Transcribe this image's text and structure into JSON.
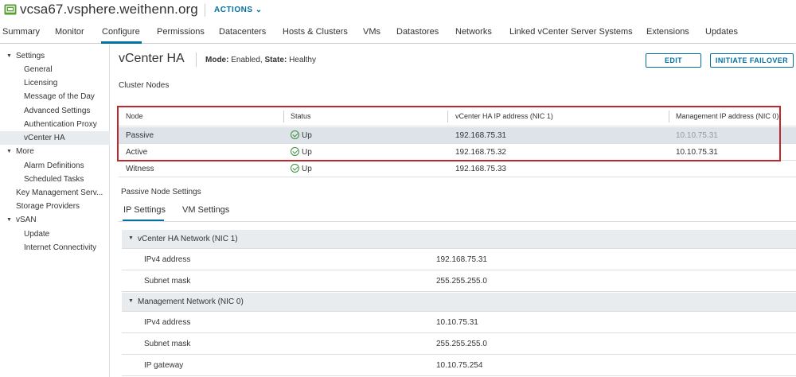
{
  "header": {
    "object_name": "vcsa67.vsphere.weithenn.org",
    "actions_label": "ACTIONS ⌄"
  },
  "tabs": [
    {
      "label": "Summary"
    },
    {
      "label": "Monitor"
    },
    {
      "label": "Configure"
    },
    {
      "label": "Permissions"
    },
    {
      "label": "Datacenters"
    },
    {
      "label": "Hosts & Clusters"
    },
    {
      "label": "VMs"
    },
    {
      "label": "Datastores"
    },
    {
      "label": "Networks"
    },
    {
      "label": "Linked vCenter Server Systems"
    },
    {
      "label": "Extensions"
    },
    {
      "label": "Updates"
    }
  ],
  "sidebar": {
    "groups": [
      {
        "label": "Settings"
      },
      {
        "label": "More"
      },
      {
        "label": "vSAN"
      }
    ],
    "items": [
      {
        "label": "General"
      },
      {
        "label": "Licensing"
      },
      {
        "label": "Message of the Day"
      },
      {
        "label": "Advanced Settings"
      },
      {
        "label": "Authentication Proxy"
      },
      {
        "label": "vCenter HA"
      },
      {
        "label": "Alarm Definitions"
      },
      {
        "label": "Scheduled Tasks"
      },
      {
        "label": "Key Management Serv..."
      },
      {
        "label": "Storage Providers"
      },
      {
        "label": "Update"
      },
      {
        "label": "Internet Connectivity"
      }
    ]
  },
  "main": {
    "title": "vCenter HA",
    "mode_label": "Mode:",
    "mode_value": "Enabled,",
    "state_label": "State:",
    "state_value": "Healthy",
    "edit_label": "EDIT",
    "failover_label": "INITIATE FAILOVER",
    "cluster_nodes_label": "Cluster Nodes",
    "columns": [
      "Node",
      "Status",
      "vCenter HA IP address (NIC 1)",
      "Management IP address (NIC 0)"
    ],
    "rows": [
      {
        "node": "Passive",
        "status": "Up",
        "ha_ip": "192.168.75.31",
        "mgmt_ip": "10.10.75.31"
      },
      {
        "node": "Active",
        "status": "Up",
        "ha_ip": "192.168.75.32",
        "mgmt_ip": "10.10.75.31"
      },
      {
        "node": "Witness",
        "status": "Up",
        "ha_ip": "192.168.75.33",
        "mgmt_ip": ""
      }
    ],
    "passive_settings_label": "Passive Node Settings",
    "subtabs": [
      {
        "label": "IP Settings"
      },
      {
        "label": "VM Settings"
      }
    ],
    "ha_network": {
      "label": "vCenter HA Network (NIC 1)",
      "ipv4_label": "IPv4 address",
      "ipv4_value": "192.168.75.31",
      "mask_label": "Subnet mask",
      "mask_value": "255.255.255.0"
    },
    "mgmt_network": {
      "label": "Management Network (NIC 0)",
      "ipv4_label": "IPv4 address",
      "ipv4_value": "10.10.75.31",
      "mask_label": "Subnet mask",
      "mask_value": "255.255.255.0",
      "gateway_label": "IP gateway",
      "gateway_value": "10.10.75.254"
    }
  },
  "colors": {
    "accent": "#0072a3",
    "status_ok": "#3e8e41",
    "highlight": "#c0272d"
  }
}
